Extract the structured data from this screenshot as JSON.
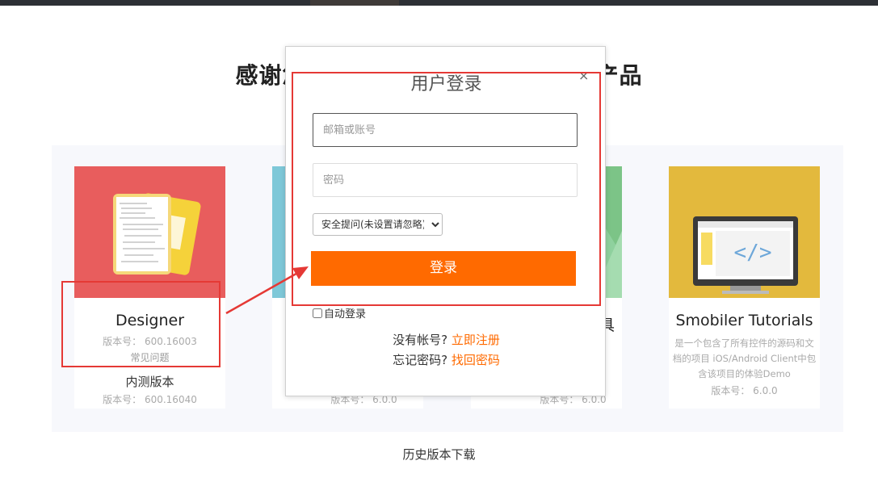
{
  "page": {
    "heading_left": "感谢您",
    "heading_right": "的产品",
    "history_link": "历史版本下载"
  },
  "cards": [
    {
      "title": "Designer",
      "meta": "版本号： 600.16003",
      "link": "常见问题",
      "sub_title": "内测版本",
      "sub_meta": "版本号： 600.16040",
      "bg": "#e85d5d"
    },
    {
      "meta": "版本号： 6.0.0",
      "bg": "#7ec8d8"
    },
    {
      "title_fragment": "具",
      "meta": "版本号： 6.0.0",
      "bg": "#8fd19e"
    },
    {
      "title": "Smobiler Tutorials",
      "desc": "是一个包含了所有控件的源码和文档的项目 iOS/Android Client中包含该项目的体验Demo",
      "meta": "版本号： 6.0.0",
      "bg": "#e3b93d"
    }
  ],
  "modal": {
    "title": "用户登录",
    "close": "×",
    "username_placeholder": "邮箱或账号",
    "password_placeholder": "密码",
    "security_question_selected": "安全提问(未设置请忽略)",
    "login_button": "登录",
    "auto_login": "自动登录",
    "no_account": "没有帐号?",
    "register_link": "立即注册",
    "forgot_password": "忘记密码?",
    "recover_link": "找回密码"
  },
  "colors": {
    "accent": "#ff6a00",
    "annotation": "#e53935"
  }
}
